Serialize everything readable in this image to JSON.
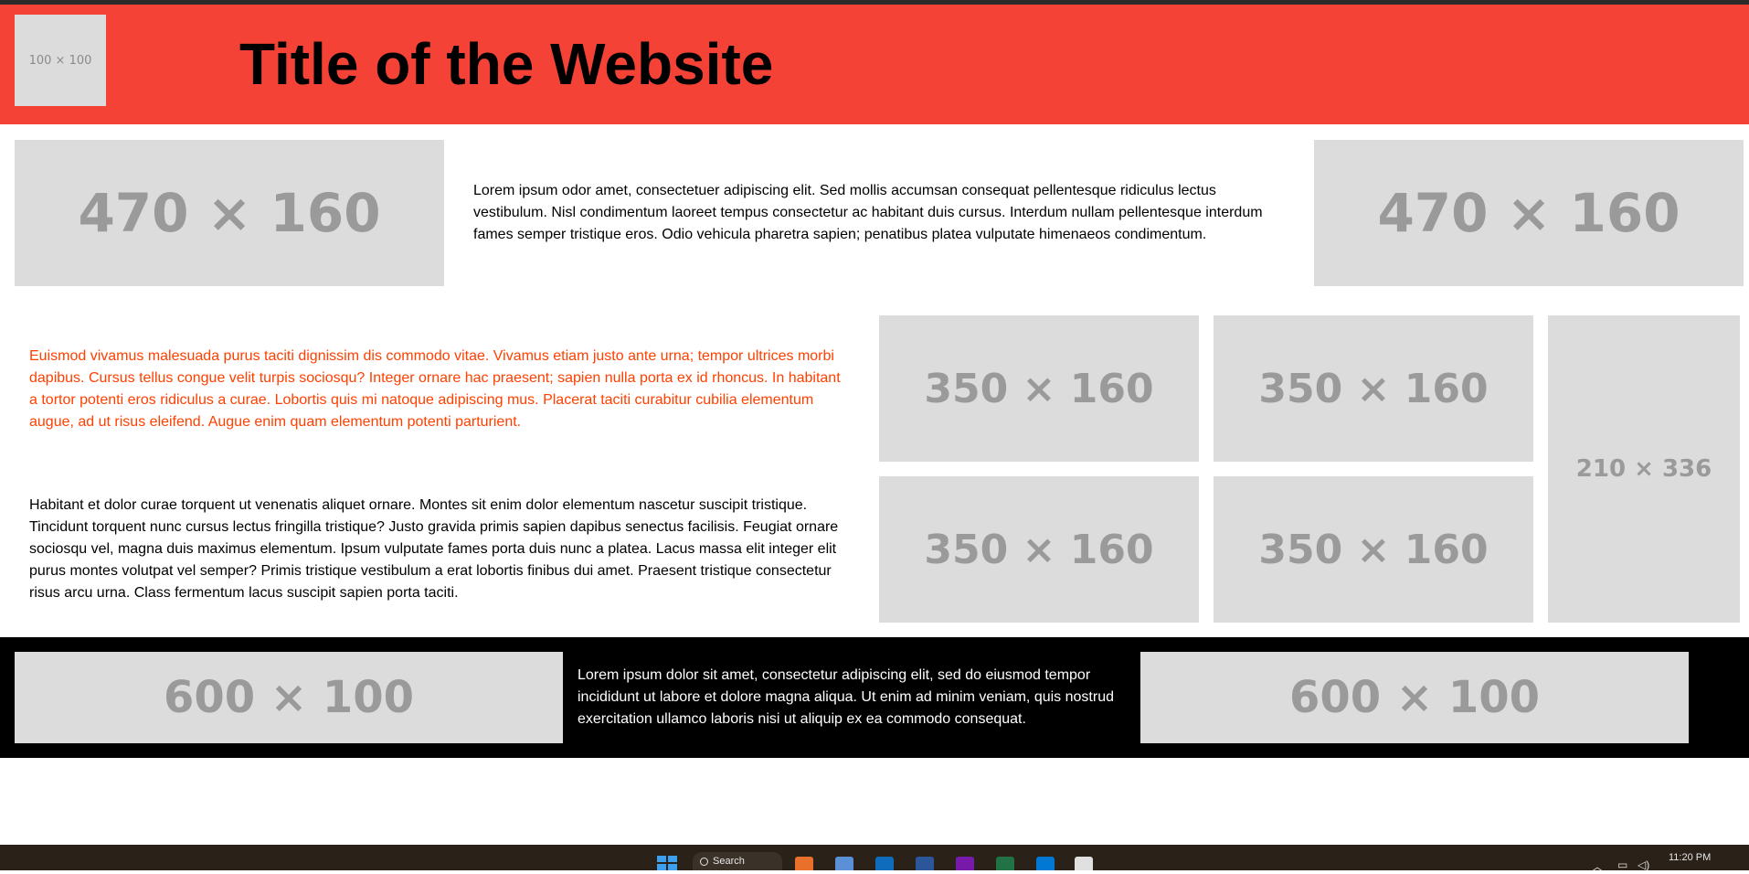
{
  "header": {
    "logo_placeholder": "100 × 100",
    "title": "Title of the Website"
  },
  "row1": {
    "left_placeholder": "470 × 160",
    "paragraph": "Lorem ipsum odor amet, consectetuer adipiscing elit. Sed mollis accumsan consequat pellentesque ridiculus lectus vestibulum. Nisl condimentum laoreet tempus consectetur ac habitant duis cursus. Interdum nullam pellentesque interdum fames semper tristique eros. Odio vehicula pharetra sapien; penatibus platea vulputate himenaeos condimentum.",
    "right_placeholder": "470 × 160"
  },
  "row2": {
    "orange_paragraph": "Euismod vivamus malesuada purus taciti dignissim dis commodo vitae. Vivamus etiam justo ante urna; tempor ultrices morbi dapibus. Cursus tellus congue velit turpis sociosqu? Integer ornare hac praesent; sapien nulla porta ex id rhoncus. In habitant a tortor potenti eros ridiculus a curae. Lobortis quis mi natoque adipiscing mus. Placerat taciti curabitur cubilia elementum augue, ad ut risus eleifend. Augue enim quam elementum potenti parturient.",
    "black_paragraph": "Habitant et dolor curae torquent ut venenatis aliquet ornare. Montes sit enim dolor elementum nascetur suscipit tristique. Tincidunt torquent nunc cursus lectus fringilla tristique? Justo gravida primis sapien dapibus senectus facilisis. Feugiat ornare sociosqu vel, magna duis maximus elementum. Ipsum vulputate fames porta duis nunc a platea. Lacus massa elit integer elit purus montes volutpat vel semper? Primis tristique vestibulum a erat lobortis finibus dui amet. Praesent tristique consectetur risus arcu urna. Class fermentum lacus suscipit sapien porta taciti.",
    "grid_placeholders": [
      "350 × 160",
      "350 × 160",
      "350 × 160",
      "350 × 160"
    ],
    "tall_placeholder": "210 × 336"
  },
  "footer": {
    "left_placeholder": "600 × 100",
    "paragraph": "Lorem ipsum dolor sit amet, consectetur adipiscing elit, sed do eiusmod tempor incididunt ut labore et dolore magna aliqua. Ut enim ad minim veniam, quis nostrud exercitation ullamco laboris nisi ut aliquip ex ea commodo consequat.",
    "right_placeholder": "600 × 100"
  },
  "taskbar": {
    "search_label": "Search",
    "clock": "11:20 PM",
    "apps": [
      "firefox-icon",
      "paint-icon",
      "outlook-icon",
      "word-icon",
      "onenote-icon",
      "excel-icon",
      "vscode-icon",
      "calendar-icon"
    ]
  },
  "colors": {
    "header_bg": "#f44336",
    "orange_text": "#ff4000",
    "placeholder_bg": "#dcdcdc",
    "placeholder_text": "#9a9a9a",
    "footer_bg": "#000000"
  }
}
